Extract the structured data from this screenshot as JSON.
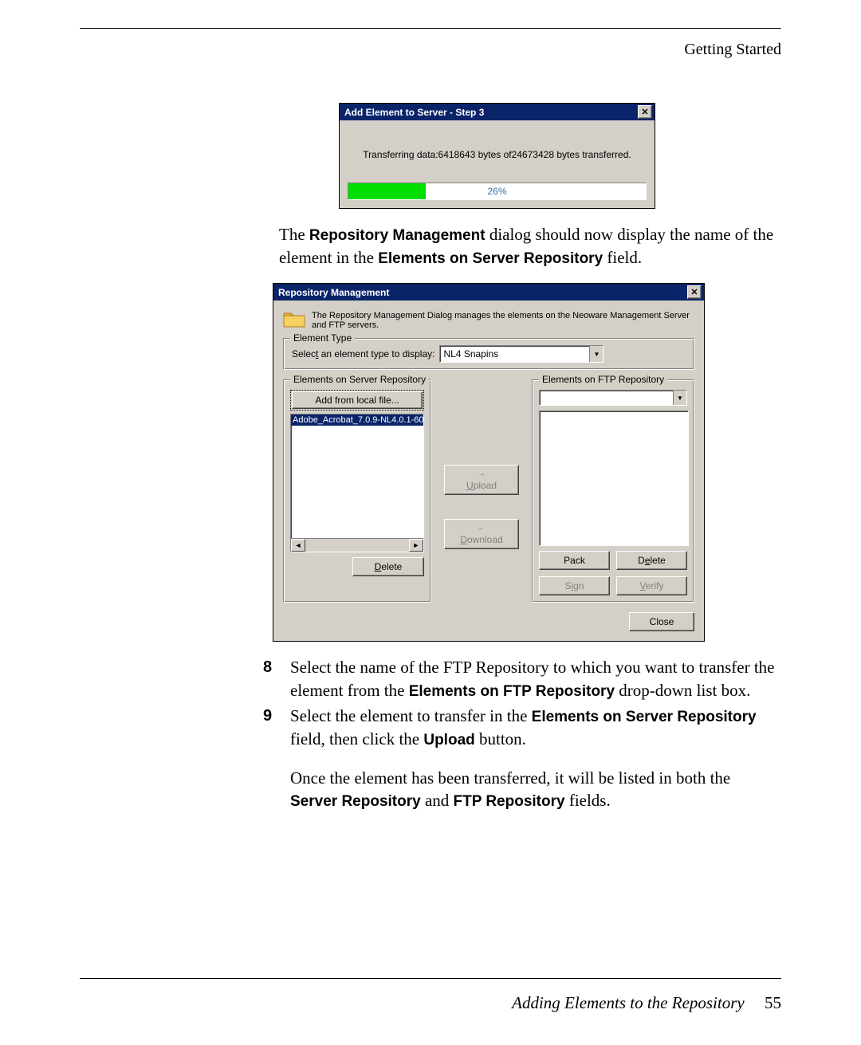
{
  "header": "Getting Started",
  "dialog1": {
    "title": "Add Element to Server - Step 3",
    "transfer_text": "Transferring data:6418643 bytes of24673428 bytes transferred.",
    "pct_label": "26%",
    "pct_value": 26
  },
  "mid_text_before": "The ",
  "mid_text_sans1": "Repository Management",
  "mid_text_middle": " dialog should now display the name of the element in the ",
  "mid_text_sans2": "Elements on Server Repository",
  "mid_text_after": " field.",
  "dialog2": {
    "title": "Repository Management",
    "desc": "The Repository Management Dialog manages the elements on the Neoware Management Server and FTP servers.",
    "element_type_group": "Element Type",
    "select_label": "Select an element type to display:",
    "select_value": "NL4 Snapins",
    "server_group": "Elements on Server Repository",
    "add_btn": "Add from local file...",
    "list_item": "Adobe_Acrobat_7.0.9-NL4.0.1-60",
    "delete_btn": "Delete",
    "upload_btn": "Upload",
    "download_btn": "Download",
    "ftp_group": "Elements on FTP Repository",
    "pack_btn": "Pack",
    "delete2_btn": "Delete",
    "sign_btn": "Sign",
    "verify_btn": "Verify",
    "close_btn": "Close"
  },
  "steps": {
    "s8_num": "8",
    "s8_p1_a": "Select the name of the FTP Repository to which you want to transfer the element from the ",
    "s8_p1_b": "Elements on FTP Repository",
    "s8_p1_c": " drop-down list box.",
    "s9_num": "9",
    "s9_p1_a": "Select the element to transfer in the ",
    "s9_p1_b": "Elements on Server Repository",
    "s9_p1_c": " field, then click the ",
    "s9_p1_d": "Upload",
    "s9_p1_e": " button.",
    "s9_p2_a": "Once the element has been transferred, it will be listed in both the ",
    "s9_p2_b": "Server Repository",
    "s9_p2_c": " and ",
    "s9_p2_d": "FTP Repository",
    "s9_p2_e": " fields."
  },
  "footer_title": "Adding Elements to the Repository",
  "page_num": "55"
}
